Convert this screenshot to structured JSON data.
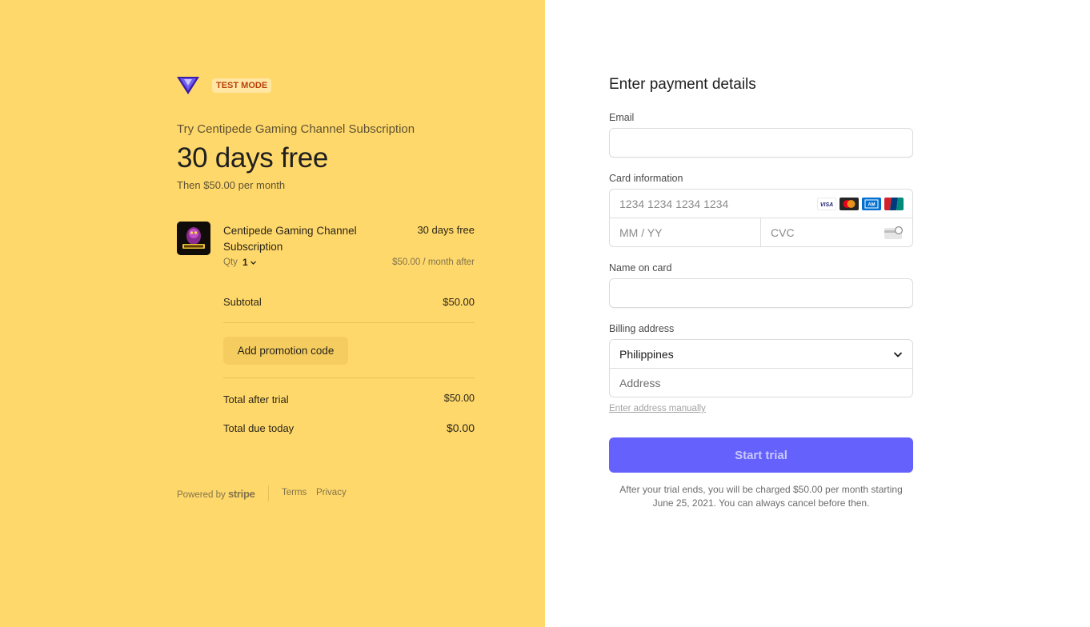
{
  "merchant": {
    "test_mode_label": "TEST MODE"
  },
  "summary": {
    "try_title": "Try Centipede Gaming Channel Subscription",
    "big_price": "30 days free",
    "then_text": "Then $50.00 per month"
  },
  "line_item": {
    "name": "Centipede Gaming Channel Subscription",
    "price": "30 days free",
    "qty_label": "Qty",
    "qty_value": "1",
    "after_price": "$50.00 / month after"
  },
  "totals": {
    "subtotal_label": "Subtotal",
    "subtotal_value": "$50.00",
    "promo_label": "Add promotion code",
    "after_trial_label": "Total after trial",
    "after_trial_value": "$50.00",
    "due_today_label": "Total due today",
    "due_today_value": "$0.00"
  },
  "footer": {
    "powered_by": "Powered by",
    "stripe": "stripe",
    "terms": "Terms",
    "privacy": "Privacy"
  },
  "payment": {
    "title": "Enter payment details",
    "email_label": "Email",
    "email_value": "",
    "card_label": "Card information",
    "card_number_placeholder": "1234 1234 1234 1234",
    "expiry_placeholder": "MM / YY",
    "cvc_placeholder": "CVC",
    "card_brands": [
      "visa-icon",
      "mastercard-icon",
      "amex-icon",
      "unionpay-icon"
    ],
    "name_label": "Name on card",
    "name_value": "",
    "billing_label": "Billing address",
    "country": "Philippines",
    "address_placeholder": "Address",
    "manual_link": "Enter address manually",
    "submit_label": "Start trial",
    "trial_note": "After your trial ends, you will be charged $50.00 per month starting June 25, 2021. You can always cancel before then."
  },
  "colors": {
    "left_bg": "#ffd86b",
    "accent": "#6461fc",
    "badge_text": "#b8410a"
  }
}
